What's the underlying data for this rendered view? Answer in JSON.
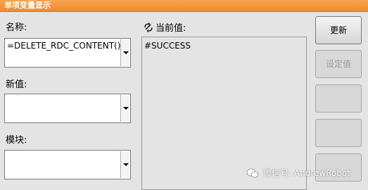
{
  "title": "单项变量显示",
  "name_field": {
    "label": "名称:",
    "value": "=DELETE_RDC_CONTENT()"
  },
  "new_value_field": {
    "label": "新值:",
    "value": ""
  },
  "module_field": {
    "label": "模块:",
    "value": ""
  },
  "current_value": {
    "label": "当前值:",
    "value": "#SUCCESS"
  },
  "buttons": {
    "update": "更新",
    "set_value": "设定值",
    "btn3": "",
    "btn4": "",
    "btn5": ""
  },
  "watermark": "微信号: AndrewRobot",
  "icons": {
    "current_value_icon": "refresh-link-icon",
    "dropdown": "chevron-down-icon",
    "watermark_icon": "wechat-icon"
  }
}
